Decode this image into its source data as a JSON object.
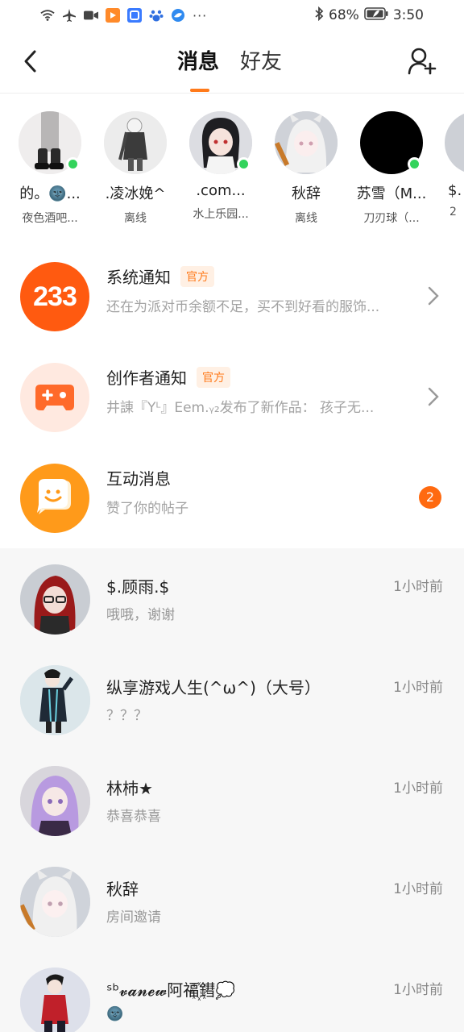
{
  "status_bar": {
    "battery": "68%",
    "time": "3:50",
    "more": "···"
  },
  "header": {
    "tabs": [
      {
        "label": "消息",
        "active": true
      },
      {
        "label": "好友",
        "active": false
      }
    ]
  },
  "friends": [
    {
      "name": "的。🌚...",
      "status": "夜色酒吧...",
      "online": true
    },
    {
      "name": ".凌冰娩^",
      "status": "离线",
      "online": false
    },
    {
      "name": ".com...",
      "status": "水上乐园...",
      "online": true
    },
    {
      "name": "秋辞",
      "status": "离线",
      "online": false
    },
    {
      "name": "苏雪（M...",
      "status": "刀刃球（...",
      "online": true
    },
    {
      "name": "$.",
      "status": "2",
      "online": false
    }
  ],
  "notifications": [
    {
      "icon_text": "233",
      "title": "系统通知",
      "badge": "官方",
      "subtitle": "还在为派对币余额不足，买不到好看的服饰..."
    },
    {
      "title": "创作者通知",
      "badge": "官方",
      "subtitle": "井諌『Yᴸ』Eem.ᵧ₂发布了新作品： 孩子无..."
    },
    {
      "title": "互动消息",
      "subtitle": "赞了你的帖子",
      "count": "2"
    }
  ],
  "chats": [
    {
      "name": "$.顾雨.$",
      "message": "哦哦，谢谢",
      "time": "1小时前"
    },
    {
      "name": "纵享游戏人生(^ω^)（大号）",
      "message": "？？？",
      "time": "1小时前"
    },
    {
      "name": "林杮★",
      "message": "恭喜恭喜",
      "time": "1小时前"
    },
    {
      "name": "秋辞",
      "message": "房间邀请",
      "time": "1小时前"
    },
    {
      "name": "ˢᵇ𝓿𝓪𝓷𝓮𝔀阿福꙰꙰鏏💭",
      "message": "🌚",
      "time": "1小时前"
    }
  ],
  "colors": {
    "accent": "#ff7a1a",
    "online": "#33d35c",
    "badge_bg": "#fff0e4"
  }
}
